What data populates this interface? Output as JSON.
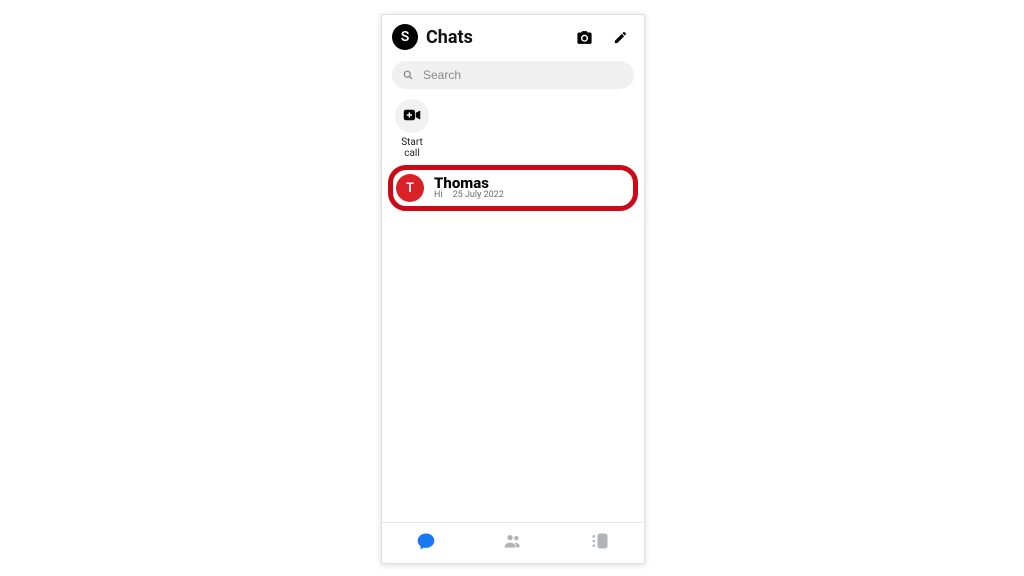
{
  "header": {
    "avatar_initial": "S",
    "title": "Chats"
  },
  "search": {
    "placeholder": "Search"
  },
  "shortcuts": {
    "start_call_label": "Start\ncall"
  },
  "chats": [
    {
      "avatar_initial": "T",
      "name": "Thomas",
      "preview": "Hi",
      "date": "25 July 2022",
      "avatar_color": "#d92127",
      "highlighted": true
    }
  ],
  "nav": {
    "active_index": 0
  },
  "colors": {
    "accent": "#1877F2",
    "highlight_border": "#cc0a17",
    "inactive_icon": "#b0b3b8"
  }
}
